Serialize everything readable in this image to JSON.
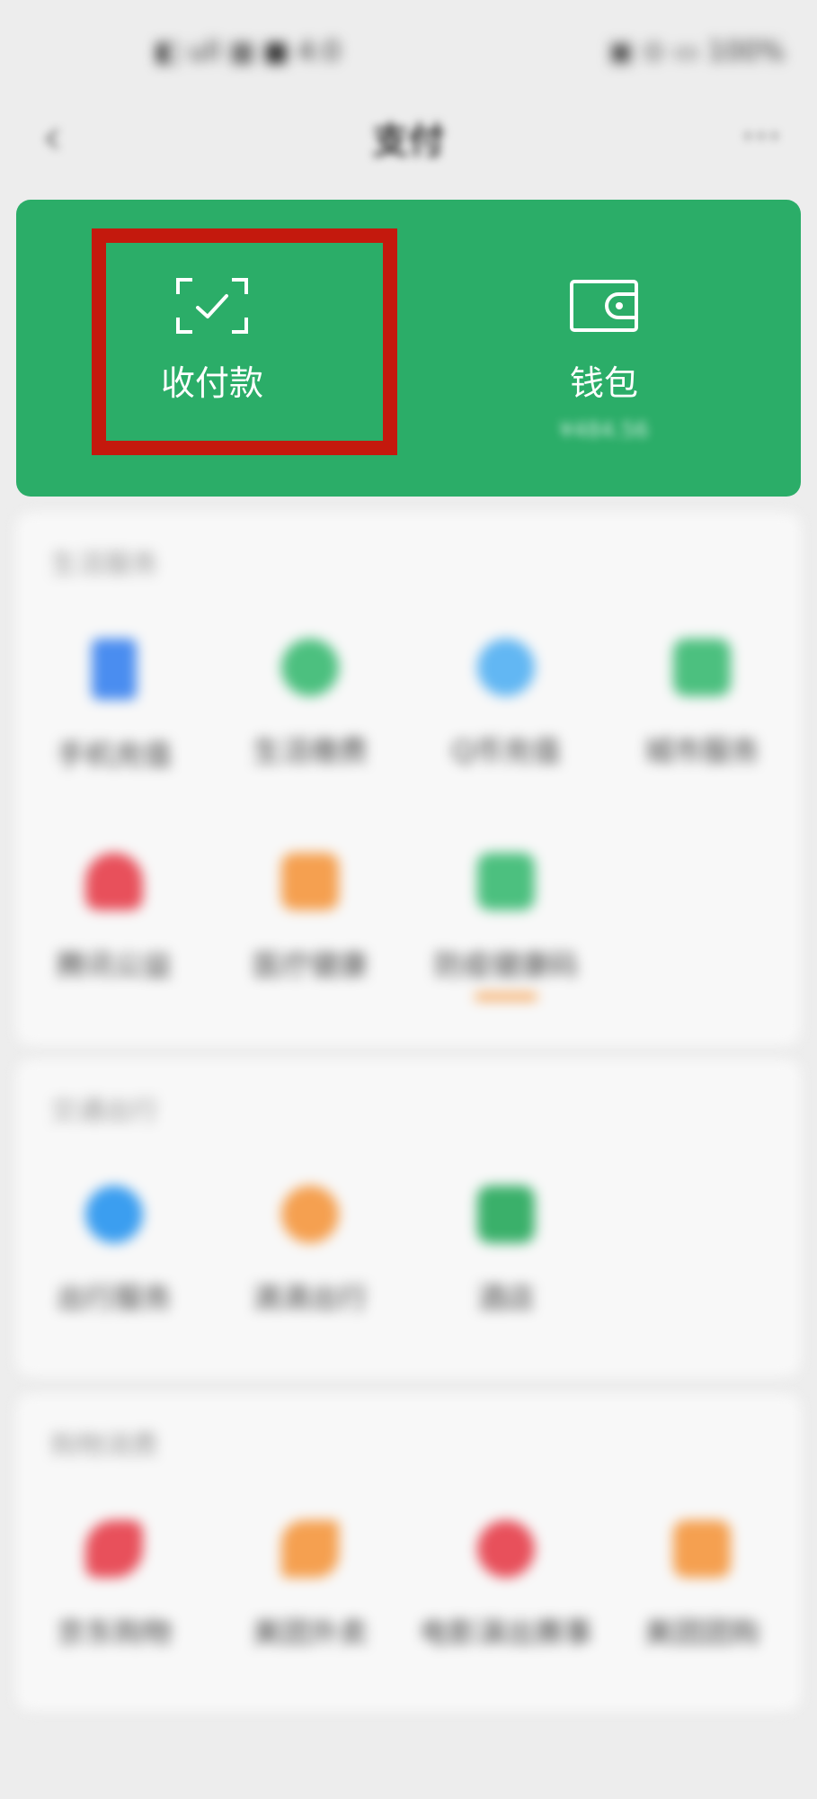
{
  "status_bar": {
    "left_text": "◧ ull ▦ ■ 4:0",
    "right_text": "▣ ⊙ ▭ 100%"
  },
  "nav": {
    "back_glyph": "‹",
    "title": "支付",
    "more_glyph": "···"
  },
  "card": {
    "pay_label": "收付款",
    "wallet_label": "钱包",
    "wallet_balance": "¥484.56",
    "background": "#2bad68",
    "highlight_color": "#c4190d"
  },
  "sections": [
    {
      "title": "生活服务",
      "items": [
        {
          "label": "手机充值",
          "icon": "phone-recharge-icon",
          "color": "#4a8df0"
        },
        {
          "label": "生活缴费",
          "icon": "utility-bill-icon",
          "color": "#4cc07f"
        },
        {
          "label": "Q币充值",
          "icon": "qcoin-icon",
          "color": "#62b7f3"
        },
        {
          "label": "城市服务",
          "icon": "city-service-icon",
          "color": "#4cc07f"
        },
        {
          "label": "腾讯公益",
          "icon": "charity-icon",
          "color": "#e8505b"
        },
        {
          "label": "医疗健康",
          "icon": "medical-icon",
          "color": "#f5a050"
        },
        {
          "label": "防疫健康码",
          "icon": "health-code-icon",
          "color": "#4cc07f"
        }
      ]
    },
    {
      "title": "交通出行",
      "items": [
        {
          "label": "出行服务",
          "icon": "travel-service-icon",
          "color": "#3b9ef0"
        },
        {
          "label": "滴滴出行",
          "icon": "didi-icon",
          "color": "#f5a050"
        },
        {
          "label": "酒店",
          "icon": "hotel-icon",
          "color": "#3ab06a"
        }
      ]
    },
    {
      "title": "购物消费",
      "items": [
        {
          "label": "京东购物",
          "icon": "jd-icon",
          "color": "#e8505b"
        },
        {
          "label": "美团外卖",
          "icon": "meituan-delivery-icon",
          "color": "#f5a050"
        },
        {
          "label": "电影演出赛事",
          "icon": "movie-icon",
          "color": "#e8505b"
        },
        {
          "label": "美团团购",
          "icon": "meituan-group-icon",
          "color": "#f5a050"
        }
      ]
    }
  ]
}
